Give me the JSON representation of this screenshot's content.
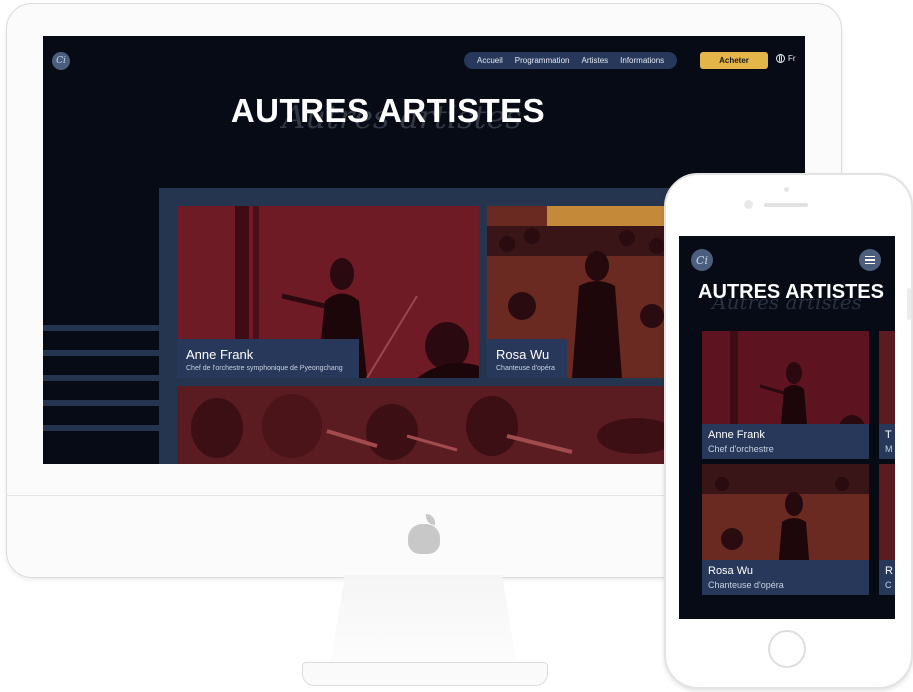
{
  "site": {
    "logo_text": "Ci",
    "nav": [
      "Accueil",
      "Programmation",
      "Artistes",
      "Informations"
    ],
    "buy_label": "Acheter",
    "language": "Fr",
    "title": "AUTRES ARTISTES",
    "title_script": "Autres artistes"
  },
  "desktop_cards": [
    {
      "name": "Anne Frank",
      "role": "Chef de l'orchestre symphonique de Pyeongchang"
    },
    {
      "name": "Rosa Wu",
      "role": "Chanteuse d'opéra"
    }
  ],
  "mobile_cards": [
    {
      "name": "Anne Frank",
      "role": "Chef d'orchestre"
    },
    {
      "name": "Rosa Wu",
      "role": "Chanteuse d'opéra"
    },
    {
      "name": "T",
      "role": "M"
    },
    {
      "name": "R",
      "role": "C"
    }
  ],
  "colors": {
    "background": "#060b16",
    "panel": "#25344f",
    "label": "#27385a",
    "accent": "#e4b64a",
    "photo_tint": "#7a1f2a"
  },
  "icons": [
    "logo-icon",
    "globe-icon",
    "apple-logo-icon",
    "hamburger-menu-icon"
  ]
}
